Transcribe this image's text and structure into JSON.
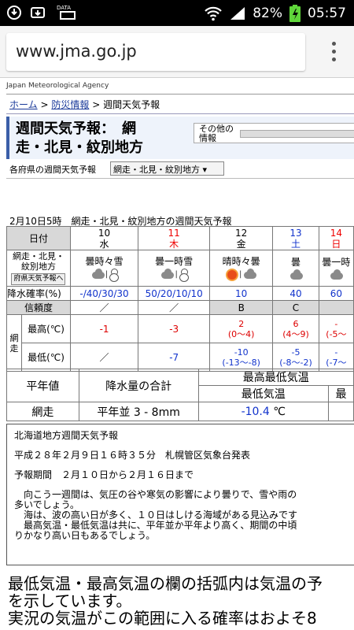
{
  "status_bar": {
    "left_icons": [
      "usb-icon",
      "download-icon",
      "data-icon"
    ],
    "data_label": "DATA",
    "battery": "82%",
    "time": "05:57"
  },
  "browser": {
    "url": "www.jma.go.jp"
  },
  "page": {
    "agency": "Japan Meteorological Agency",
    "breadcrumb": [
      "ホーム",
      "防災情報",
      "週間天気予報"
    ],
    "title_line1": "週間天気予報：　網",
    "title_line2": "走・北見・紋別地方",
    "other_info_line1": "その他の",
    "other_info_line2": "情報",
    "pref_label": "各府県の週間天気予報",
    "pref_select": "網走・北見・紋別地方",
    "issued": "2月10日5時　網走・北見・紋別地方の週間天気予報"
  },
  "forecast": {
    "header_label": "日付",
    "area_line1": "網走・北見・",
    "area_line2": "紋別地方",
    "pref_button": "府県天気予報へ",
    "precip_label": "降水確率(%)",
    "reliability_label": "信頼度",
    "region_label": "網走",
    "max_label": "最高(℃)",
    "min_label": "最低(℃)",
    "days": [
      {
        "day": "10",
        "wd": "水",
        "wx": "曇時々雪",
        "pop": "-/40/30/30",
        "rel": "／",
        "max": "-1",
        "max_rng": "",
        "min": "／",
        "min_rng": ""
      },
      {
        "day": "11",
        "wd": "木",
        "wx": "曇一時雪",
        "pop": "50/20/10/10",
        "rel": "／",
        "max": "-3",
        "max_rng": "",
        "min": "-7",
        "min_rng": ""
      },
      {
        "day": "12",
        "wd": "金",
        "wx": "晴時々曇",
        "pop": "10",
        "rel": "B",
        "max": "2",
        "max_rng": "(0～4)",
        "min": "-10",
        "min_rng": "(-13～-8)"
      },
      {
        "day": "13",
        "wd": "土",
        "wx": "曇",
        "pop": "40",
        "rel": "C",
        "max": "6",
        "max_rng": "(4～9)",
        "min": "-5",
        "min_rng": "(-8～-2)"
      },
      {
        "day": "14",
        "wd": "日",
        "wx": "曇一時",
        "pop": "60",
        "rel": "",
        "max": "-",
        "max_rng": "(-5～",
        "min": "-",
        "min_rng": "(-7～"
      }
    ]
  },
  "normals": {
    "label": "平年値",
    "precip_header": "降水量の合計",
    "temp_header": "最高最低気温",
    "min_header": "最低気温",
    "max_header_cut": "最",
    "region": "網走",
    "precip_value": "平年並 3 - 8mm",
    "min_value": "-10.4",
    "unit": "℃"
  },
  "text": {
    "heading": "北海道地方週間天気予報",
    "issued": "平成２８年２月９日１６時３５分　札幌管区気象台発表",
    "period": "予報期間　２月１０日から２月１６日まで",
    "body": [
      "　向こう一週間は、気圧の谷や寒気の影響により曇りで、雪や雨の",
      "多いでしょう。",
      "　海は、波の高い日が多く、１０日はしける海域がある見込みです",
      "　最高気温・最低気温は共に、平年並か平年より高く、期間の中頃",
      "りかなり高い日もあるでしょう。"
    ]
  },
  "note": [
    "最低気温・最高気温の欄の括弧内は気温の予",
    "を示しています。",
    "実況の気温がこの範囲に入る確率はおよそ8"
  ]
}
